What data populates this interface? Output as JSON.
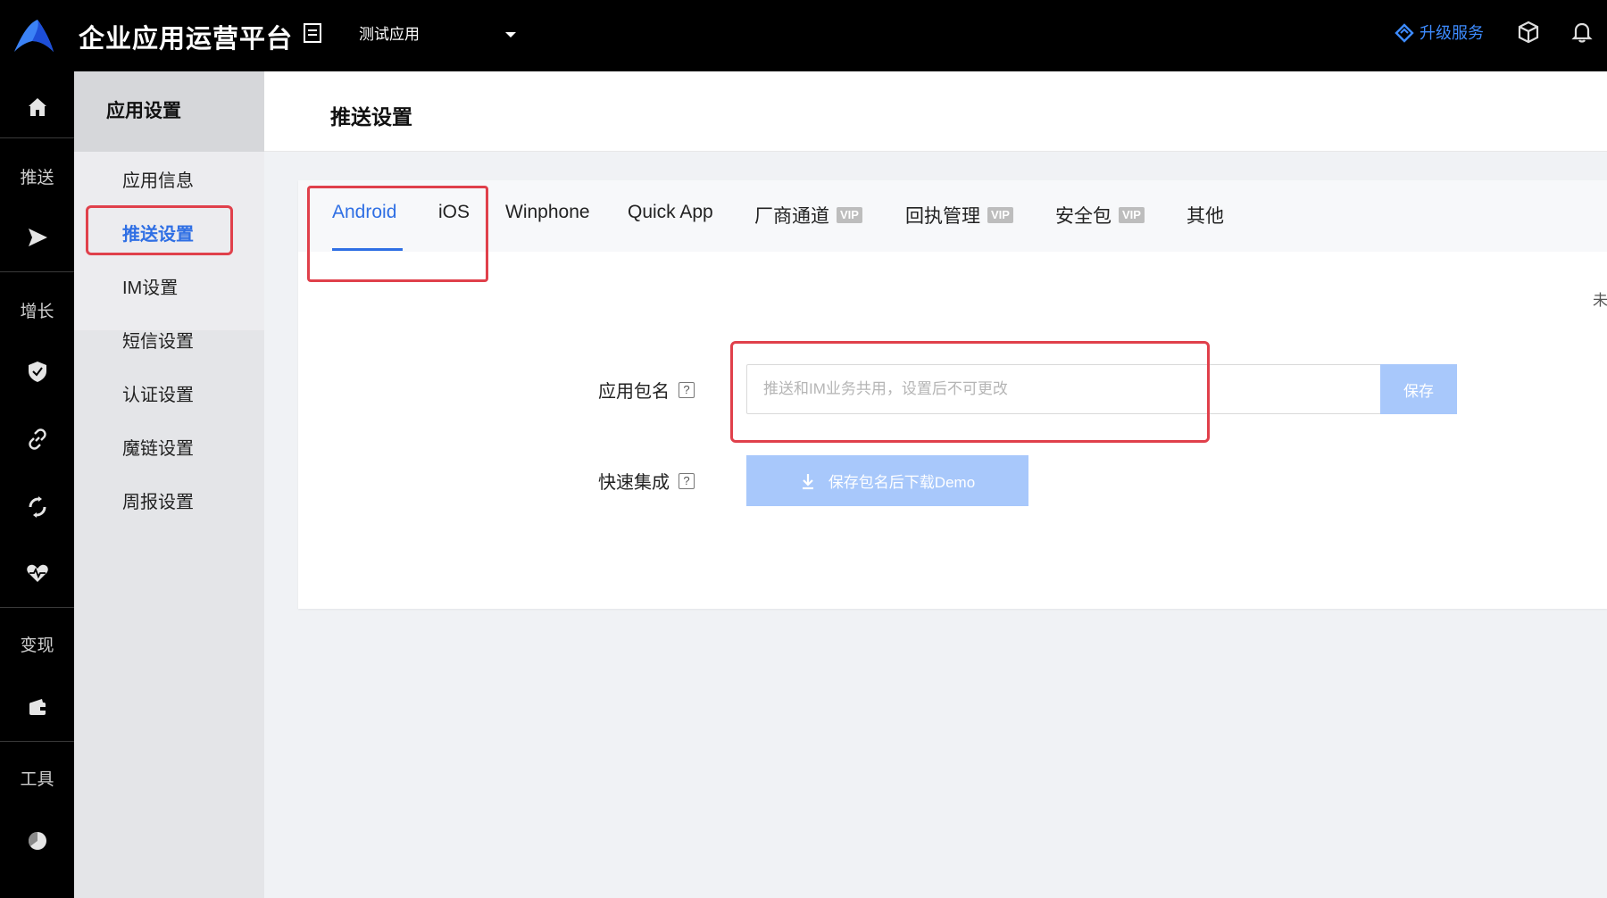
{
  "header": {
    "brand": "企业应用运营平台",
    "app_selector": "测试应用",
    "upgrade_label": "升级服务",
    "accent": "#3d8bff"
  },
  "rail": {
    "section_labels": [
      "推送",
      "增长",
      "变现",
      "工具"
    ],
    "icons": [
      "home-icon",
      "send-icon",
      "shield-icon",
      "link-icon",
      "sync-icon",
      "heart-pulse-icon",
      "wallet-icon",
      "pie-chart-icon"
    ]
  },
  "subnav": {
    "title": "应用设置",
    "items": [
      {
        "label": "应用信息",
        "active": false
      },
      {
        "label": "推送设置",
        "active": true
      },
      {
        "label": "IM设置",
        "active": false
      },
      {
        "label": "短信设置",
        "active": false
      },
      {
        "label": "认证设置",
        "active": false
      },
      {
        "label": "魔链设置",
        "active": false
      },
      {
        "label": "周报设置",
        "active": false
      }
    ]
  },
  "page": {
    "title": "推送设置"
  },
  "tabs": [
    {
      "label": "Android",
      "active": true,
      "vip": ""
    },
    {
      "label": "iOS",
      "active": false,
      "vip": ""
    },
    {
      "label": "Winphone",
      "active": false,
      "vip": ""
    },
    {
      "label": "Quick App",
      "active": false,
      "vip": ""
    },
    {
      "label": "厂商通道",
      "active": false,
      "vip": "VIP"
    },
    {
      "label": "回执管理",
      "active": false,
      "vip": "VIP"
    },
    {
      "label": "安全包",
      "active": false,
      "vip": "VIP"
    },
    {
      "label": "其他",
      "active": false,
      "vip": ""
    }
  ],
  "edge_text": "未",
  "form": {
    "package_label": "应用包名",
    "package_value": "",
    "package_placeholder": "推送和IM业务共用，设置后不可更改",
    "save_label": "保存",
    "quick_label": "快速集成",
    "help_mark": "?",
    "demo_button": "保存包名后下载Demo"
  },
  "colors": {
    "highlight": "#e0404b",
    "primary": "#2f6fe4",
    "button_disabled": "#a8c8fb"
  }
}
